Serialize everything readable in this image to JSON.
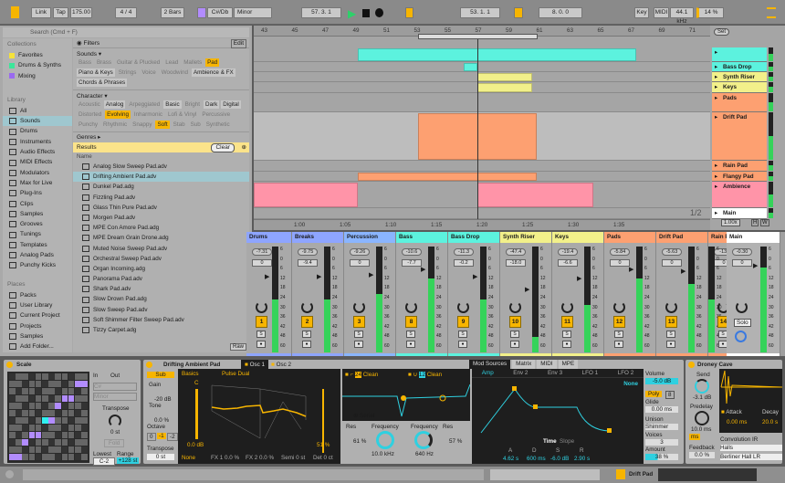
{
  "colors": {
    "accent": "#f7b500",
    "cyan": "#5cf2de",
    "yellow": "#f2f08a",
    "orange": "#fda071",
    "pink": "#ff94a8",
    "blue": "#8ea5ff",
    "selection": "#9fc7cf"
  },
  "transport": {
    "link": "Link",
    "tap": "Tap",
    "tempo": "175.00",
    "signature": "4 / 4",
    "quantize": "2 Bars",
    "key": "C#/Db",
    "scale": "Minor",
    "position": "57.  3.  1",
    "loop_start": "53.  1.  1",
    "loop_length": "8.  0.  0",
    "key_btn": "Key",
    "midi_btn": "MIDI",
    "sample_rate": "44.1 kHz",
    "cpu": "14 %"
  },
  "browser": {
    "search_placeholder": "Search (Cmd + F)",
    "collections_label": "Collections",
    "collections": [
      {
        "label": "Favorites",
        "color": "#f5e23a"
      },
      {
        "label": "Drums & Synths",
        "color": "#3ce69a"
      },
      {
        "label": "Mixing",
        "color": "#9a6af0"
      }
    ],
    "library_label": "Library",
    "library": [
      {
        "label": "All",
        "icon": "grid-icon"
      },
      {
        "label": "Sounds",
        "icon": "note-icon",
        "selected": true
      },
      {
        "label": "Drums",
        "icon": "drum-pads-icon"
      },
      {
        "label": "Instruments",
        "icon": "instrument-icon"
      },
      {
        "label": "Audio Effects",
        "icon": "audio-effect-icon"
      },
      {
        "label": "MIDI Effects",
        "icon": "midi-effect-icon"
      },
      {
        "label": "Modulators",
        "icon": "modulator-icon"
      },
      {
        "label": "Max for Live",
        "icon": "max-icon"
      },
      {
        "label": "Plug-Ins",
        "icon": "plugin-icon"
      },
      {
        "label": "Clips",
        "icon": "clip-icon"
      },
      {
        "label": "Samples",
        "icon": "sample-icon"
      },
      {
        "label": "Grooves",
        "icon": "groove-icon"
      },
      {
        "label": "Tunings",
        "icon": "tuning-icon"
      },
      {
        "label": "Templates",
        "icon": "template-icon"
      },
      {
        "label": "Analog Pads",
        "icon": "label-icon"
      },
      {
        "label": "Punchy Kicks",
        "icon": "label-icon"
      }
    ],
    "places_label": "Places",
    "places": [
      {
        "label": "Packs",
        "icon": "packs-icon"
      },
      {
        "label": "User Library",
        "icon": "user-icon"
      },
      {
        "label": "Current Project",
        "icon": "project-icon"
      },
      {
        "label": "Projects",
        "icon": "folder-icon"
      },
      {
        "label": "Samples",
        "icon": "folder-icon"
      },
      {
        "label": "Add Folder...",
        "icon": "add-folder-icon"
      }
    ],
    "filters_label": "Filters",
    "edit_label": "Edit",
    "sounds_label": "Sounds ▾",
    "sounds_tags": [
      {
        "t": "Bass"
      },
      {
        "t": "Brass"
      },
      {
        "t": "Guitar & Plucked"
      },
      {
        "t": "Lead"
      },
      {
        "t": "Mallets"
      },
      {
        "t": "Pad",
        "s": "hl"
      },
      {
        "t": "Piano & Keys",
        "s": "on"
      },
      {
        "t": "Strings"
      },
      {
        "t": "Voice"
      },
      {
        "t": "Woodwind"
      },
      {
        "t": "Ambience & FX",
        "s": "on"
      },
      {
        "t": "Chords & Phrases",
        "s": "on"
      }
    ],
    "character_label": "Character ▾",
    "character_tags": [
      {
        "t": "Acoustic"
      },
      {
        "t": "Analog",
        "s": "on"
      },
      {
        "t": "Arpeggiated"
      },
      {
        "t": "Basic",
        "s": "on"
      },
      {
        "t": "Bright"
      },
      {
        "t": "Dark",
        "s": "on"
      },
      {
        "t": "Digital",
        "s": "on"
      },
      {
        "t": "Distorted"
      },
      {
        "t": "Evolving",
        "s": "hl"
      },
      {
        "t": "Inharmonic"
      },
      {
        "t": "Lofi & Vinyl"
      },
      {
        "t": "Percussive"
      },
      {
        "t": "Punchy"
      },
      {
        "t": "Rhythmic"
      },
      {
        "t": "Snappy"
      },
      {
        "t": "Soft",
        "s": "hl"
      },
      {
        "t": "Stab"
      },
      {
        "t": "Sub"
      },
      {
        "t": "Synthetic"
      }
    ],
    "genres_label": "Genres ▸",
    "results_label": "Results",
    "clear_label": "Clear",
    "name_col": "Name",
    "raw_label": "Raw",
    "results": [
      "Analog Slow Sweep Pad.adv",
      "Drifting Ambient Pad.adv",
      "Dunkel Pad.adg",
      "Fizzling Pad.adv",
      "Glass Thin Pure Pad.adv",
      "Morgen Pad.adv",
      "MPE Con Amore Pad.adg",
      "MPE Dream Grain Drone.adg",
      "Muted Noise Sweep Pad.adv",
      "Orchestral Sweep Pad.adv",
      "Organ Incoming.adg",
      "Panorama Pad.adv",
      "Shark Pad.adv",
      "Slow Drown Pad.adg",
      "Slow Sweep Pad.adv",
      "Soft Shimmer Filter Sweep Pad.adv",
      "Tizzy Carpet.adg"
    ],
    "selected_result": 1
  },
  "arrangement": {
    "bars": [
      "43",
      "45",
      "47",
      "49",
      "51",
      "53",
      "55",
      "57",
      "59",
      "61",
      "63",
      "65",
      "67",
      "69",
      "71"
    ],
    "times": [
      "1:00",
      "1:05",
      "1:10",
      "1:15",
      "1:20",
      "1:25",
      "1:30",
      "1:35"
    ],
    "set_label": "Set",
    "page": "1/2",
    "zoom": "1.00x",
    "h": "H",
    "w": "W",
    "tracks": [
      {
        "name": "",
        "color": "#5cf2de"
      },
      {
        "name": "Bass Drop",
        "color": "#5cf2de"
      },
      {
        "name": "Synth Riser",
        "color": "#f2f08a"
      },
      {
        "name": "Keys",
        "color": "#f2f08a"
      },
      {
        "name": "Pads",
        "color": "#fda071"
      },
      {
        "name": "Drift Pad",
        "color": "#fda071"
      },
      {
        "name": "Rain Pad",
        "color": "#fda071"
      },
      {
        "name": "Flangy Pad",
        "color": "#fda071"
      },
      {
        "name": "Ambience",
        "color": "#ff94a8"
      },
      {
        "name": "Main",
        "color": "#ffffff"
      }
    ]
  },
  "mixer": [
    {
      "name": "Drums",
      "color": "#8ea5ff",
      "peak": "-?.31",
      "vol": "0",
      "num": "1",
      "level": 0.5
    },
    {
      "name": "Breaks",
      "color": "#8ea5ff",
      "peak": "-9.75",
      "vol": "-9.4",
      "num": "2",
      "level": 0.5
    },
    {
      "name": "Percussion",
      "color": "#8ab5ff",
      "peak": "-9.26",
      "vol": "0",
      "num": "3",
      "level": 0.55
    },
    {
      "name": "Bass",
      "color": "#5cf2de",
      "peak": "-10.6",
      "vol": "-7.7",
      "num": "8",
      "level": 0.7
    },
    {
      "name": "Bass Drop",
      "color": "#5cf2de",
      "peak": "-11.3",
      "vol": "-0.2",
      "num": "9",
      "level": 0.5
    },
    {
      "name": "Synth Riser",
      "color": "#f2f08a",
      "peak": "-47.4",
      "vol": "-18.0",
      "num": "10",
      "level": 0.15
    },
    {
      "name": "Keys",
      "color": "#f2f08a",
      "peak": "-19.4",
      "vol": "-6.6",
      "num": "11",
      "level": 0.45
    },
    {
      "name": "Pads",
      "color": "#fda071",
      "peak": "-5.84",
      "vol": "0",
      "num": "12",
      "level": 0.7
    },
    {
      "name": "Drift Pad",
      "color": "#fda071",
      "peak": "-5.63",
      "vol": "0",
      "num": "13",
      "level": 0.65
    },
    {
      "name": "Rain Pad",
      "color": "#fda071",
      "peak": "-13.",
      "vol": "0",
      "num": "14",
      "level": 0.5
    }
  ],
  "main": {
    "name": "Main",
    "peak": "-0.30",
    "vol": "0",
    "solo": "Solo",
    "level": 0.8
  },
  "meter_scale": [
    "6",
    "0",
    "6",
    "12",
    "18",
    "24",
    "30",
    "36",
    "42",
    "48",
    "60"
  ],
  "scale_device": {
    "title": "Scale",
    "in": "In",
    "out": "Out",
    "key": "C#",
    "mode": "Minor",
    "transpose_label": "Transpose",
    "transpose": "0 st",
    "fold": "Fold",
    "lowest_label": "Lowest",
    "lowest": "C-2",
    "range_label": "Range",
    "range": "+128 st"
  },
  "drift": {
    "title": "Drifting Ambient Pad",
    "osc1": "Osc 1",
    "osc2": "Osc 2",
    "sub": "Sub",
    "gain_label": "Gain",
    "gain": "-20 dB",
    "tone_label": "Tone",
    "tone": "0.0 %",
    "octave_label": "Octave",
    "octaves": [
      "0",
      "-1",
      "-2"
    ],
    "transpose_label": "Transpose",
    "transpose": "0 st",
    "wavetable_cat": "Basics",
    "wavetable": "Pulse Dual",
    "pitch": "C",
    "osc_gain": "0.0 dB",
    "pos": "51 %",
    "fx_mode": "None",
    "fx1": "FX 1  0.0 %",
    "fx2": "FX 2  0.0 %",
    "semi": "Semi  0 st",
    "det": "Det  0 ct",
    "filter1": "24",
    "filter1_type": "Clean",
    "filter2": "12",
    "filter2_type": "Clean",
    "routing": "Serial",
    "res1_label": "Res",
    "res1": "61 %",
    "freq1_label": "Frequency",
    "freq1": "10.0 kHz",
    "freq2_label": "Frequency",
    "freq2": "640 Hz",
    "res2_label": "Res",
    "res2": "57 %",
    "mod_tabs": [
      "Mod Sources",
      "Matrix",
      "MIDI",
      "MPE"
    ],
    "env_tabs": [
      "Amp",
      "Env 2",
      "Env 3",
      "LFO 1",
      "LFO 2"
    ],
    "env_none": "None",
    "time": "Time",
    "slope": "Slope",
    "adsr_labels": [
      "A",
      "D",
      "S",
      "R"
    ],
    "adsr": [
      "4.62 s",
      "600 ms",
      "-6.0 dB",
      "2.90 s"
    ],
    "volume_label": "Volume",
    "volume": "-5.0 dB",
    "poly": "Poly",
    "voices_n": "8",
    "glide_label": "Glide",
    "glide": "0.00 ms",
    "unison_label": "Unison",
    "unison": "Shimmer",
    "voices_label": "Voices",
    "voices": "3",
    "amount_label": "Amount",
    "amount": "38 %"
  },
  "reverb": {
    "title": "Droney Cave",
    "send_label": "Send",
    "send": "-3.1 dB",
    "predelay_label": "Predelay",
    "predelay": "10.0 ms",
    "ms": "ms",
    "attack_label": "Attack",
    "attack": "0.00 ms",
    "decay_label": "Decay",
    "decay": "20.0 s",
    "feedback_label": "Feedback",
    "feedback": "0.0 %",
    "ir_label": "Convolution IR",
    "ir_cat": "Halls",
    "ir": "Berliner Hall LR"
  },
  "status": {
    "track": "Drift Pad"
  }
}
